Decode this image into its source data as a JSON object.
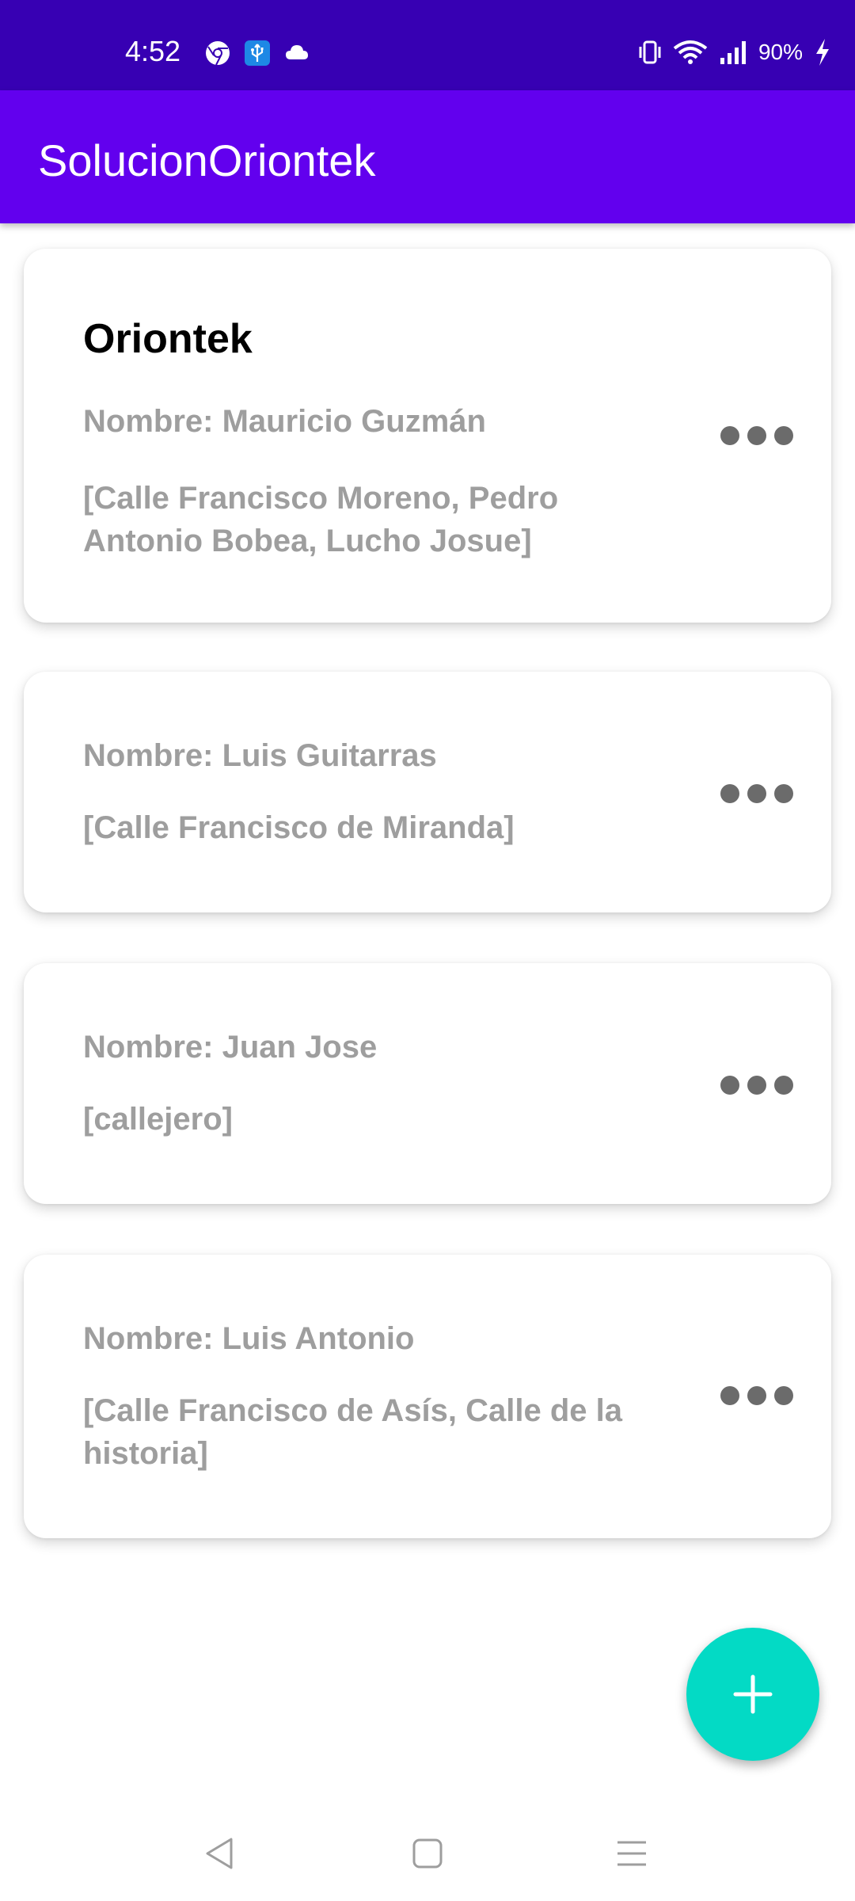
{
  "status_bar": {
    "time": "4:52",
    "battery": "90%",
    "left_icons": [
      "chrome-icon",
      "usb-icon",
      "cloud-icon"
    ],
    "right_icons": [
      "vibrate-icon",
      "wifi-icon",
      "signal-icon",
      "charging-icon"
    ]
  },
  "app_bar": {
    "title": "SolucionOriontek",
    "color": "#6200EE"
  },
  "clients": [
    {
      "company": "Oriontek",
      "name": "Nombre: Mauricio Guzmán",
      "addresses": "[Calle Francisco Moreno,  Pedro Antonio Bobea,  Lucho Josue]"
    },
    {
      "company": "",
      "name": "Nombre: Luis Guitarras",
      "addresses": "[Calle Francisco de Miranda]"
    },
    {
      "company": "",
      "name": "Nombre: Juan Jose",
      "addresses": "[callejero]"
    },
    {
      "company": "",
      "name": "Nombre: Luis Antonio",
      "addresses": "[Calle Francisco de Asís,  Calle de la historia]"
    }
  ],
  "fab": {
    "icon": "plus-icon",
    "color": "#03DAC5"
  },
  "nav": {
    "icons": [
      "back-icon",
      "home-icon",
      "recents-icon"
    ]
  }
}
